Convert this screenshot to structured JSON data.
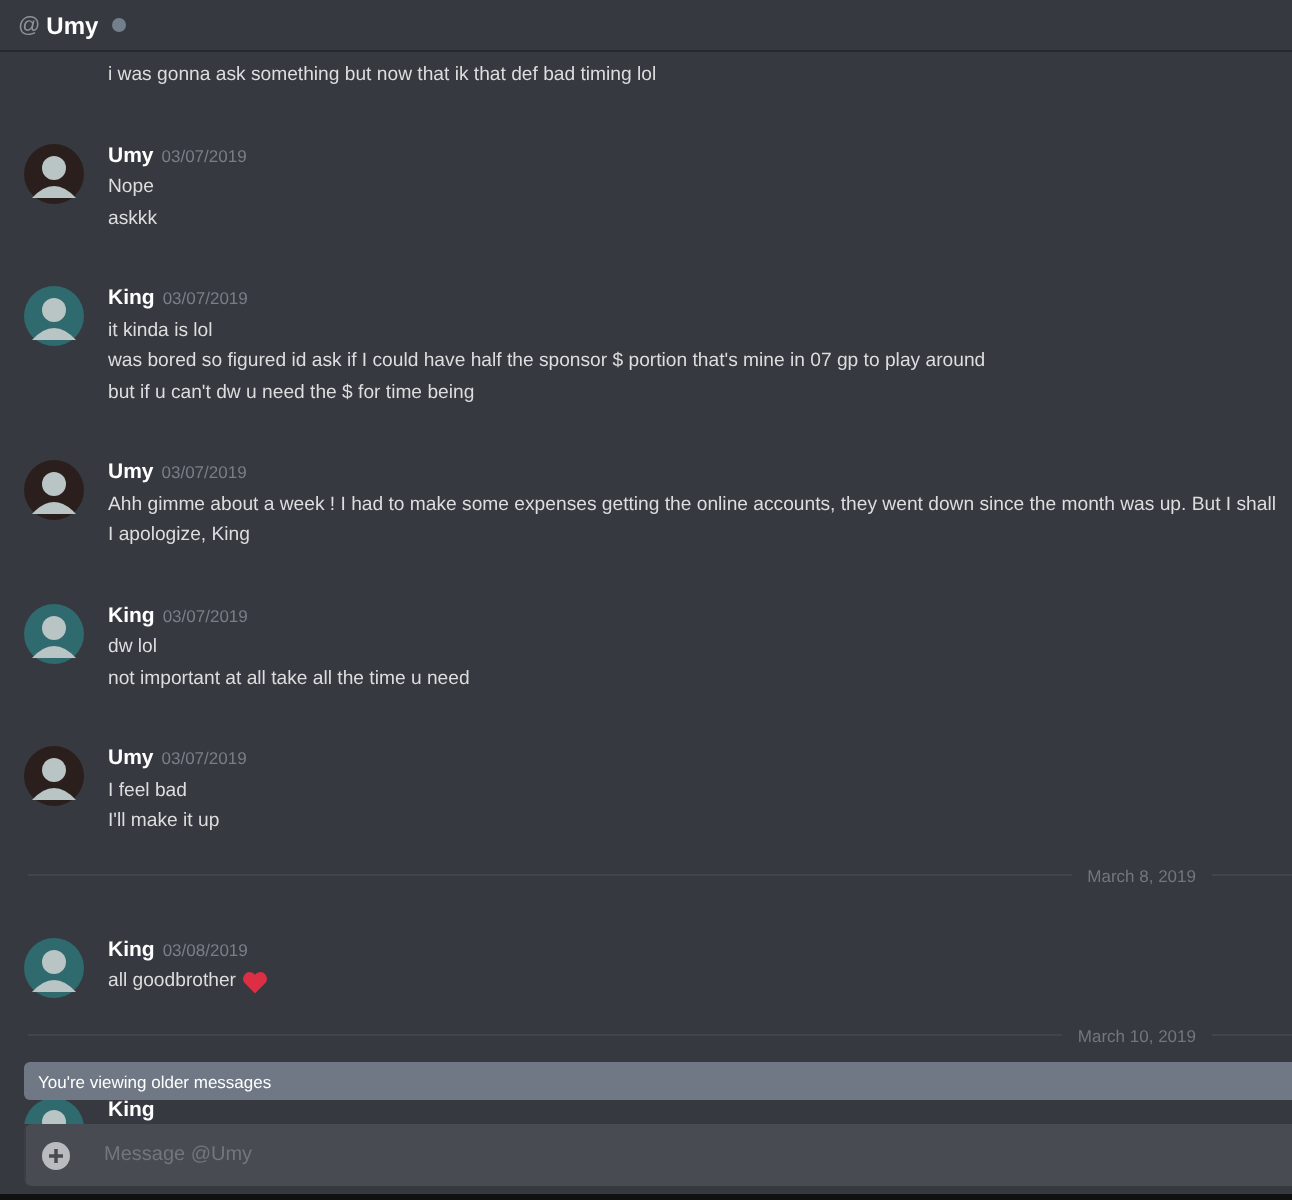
{
  "header": {
    "at_sign": "@",
    "name": "Umy",
    "online": false
  },
  "messages": [
    {
      "kind": "continuation",
      "lines": [
        "i was gonna ask something but now that ik that def bad timing lol"
      ]
    },
    {
      "kind": "message",
      "color": "#2a1f1c",
      "author": "Umy",
      "timestamp": "03/07/2019",
      "lines": [
        "Nope",
        "askkk"
      ]
    },
    {
      "kind": "message",
      "color": "#2f6a6e",
      "author": "King",
      "timestamp": "03/07/2019",
      "lines": [
        "it kinda is lol",
        "was bored so figured id ask if I could have half the sponsor $ portion that's mine in 07 gp to play around",
        "but if u can't dw u need the $ for time being"
      ]
    },
    {
      "kind": "message",
      "color": "#2a1f1c",
      "author": "Umy",
      "timestamp": "03/07/2019",
      "lines": [
        "Ahh gimme about a week ! I had to make some expenses getting the online accounts, they went down since the month was up. But I shall",
        "I apologize, King"
      ]
    },
    {
      "kind": "message",
      "color": "#2f6a6e",
      "author": "King",
      "timestamp": "03/07/2019",
      "lines": [
        "dw lol",
        "not important at all take all the time u need"
      ]
    },
    {
      "kind": "message",
      "color": "#2a1f1c",
      "author": "Umy",
      "timestamp": "03/07/2019",
      "lines": [
        "I feel bad",
        "I'll make it up"
      ]
    },
    {
      "kind": "divider",
      "label": "March 8, 2019"
    },
    {
      "kind": "message",
      "color": "#2f6a6e",
      "author": "King",
      "timestamp": "03/08/2019",
      "lines": [
        "all goodbrother"
      ],
      "trailing_emoji": true
    },
    {
      "kind": "divider",
      "label": "March 10, 2019"
    },
    {
      "kind": "message",
      "color": "#2f6a6e",
      "author": "King"
    }
  ],
  "banner": "You're viewing older messages",
  "composer": {
    "placeholder": "Message @Umy"
  }
}
